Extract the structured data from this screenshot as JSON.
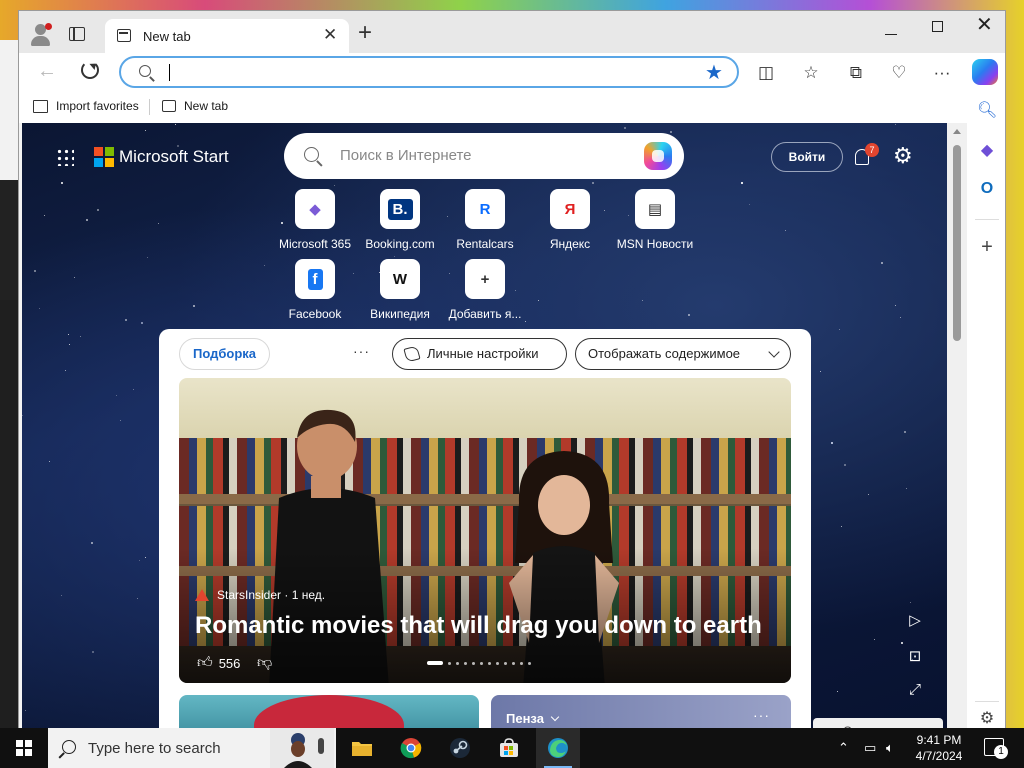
{
  "browser": {
    "tab_title": "New tab",
    "address_placeholder": "",
    "favorites": [
      {
        "label": "Import favorites"
      },
      {
        "label": "New tab"
      }
    ]
  },
  "page": {
    "brand": "Microsoft Start",
    "search_placeholder": "Поиск в Интернете",
    "signin_label": "Войти",
    "notification_count": "7",
    "quick_links": [
      {
        "label": "Microsoft 365",
        "glyph": "◆",
        "color": "#7b5bd6"
      },
      {
        "label": "Booking.com",
        "glyph": "B.",
        "color": "#fff",
        "bg": "#003580"
      },
      {
        "label": "Rentalcars",
        "glyph": "R",
        "color": "#0a6cff"
      },
      {
        "label": "Яндекс",
        "glyph": "Я",
        "color": "#e02020"
      },
      {
        "label": "MSN Новости",
        "glyph": "▤",
        "color": "#222"
      },
      {
        "label": "Facebook",
        "glyph": "f",
        "color": "#fff",
        "bg": "#1877f2"
      },
      {
        "label": "Википедия",
        "glyph": "W",
        "color": "#111"
      },
      {
        "label": "Добавить я...",
        "glyph": "+",
        "color": "#333"
      }
    ],
    "feed": {
      "curated_label": "Подборка",
      "more_label": "···",
      "personalize_label": "Личные настройки",
      "show_content_label": "Отображать содержимое",
      "hero": {
        "source": "StarsInsider · 1 нед.",
        "title": "Romantic movies that will drag you down to earth",
        "likes": "556"
      },
      "weather_city": "Пенза",
      "weather_more": "···"
    },
    "feedback_label": "Отзыв"
  },
  "taskbar": {
    "search_placeholder": "Type here to search",
    "time": "9:41 PM",
    "date": "4/7/2024",
    "notification_count": "1"
  }
}
